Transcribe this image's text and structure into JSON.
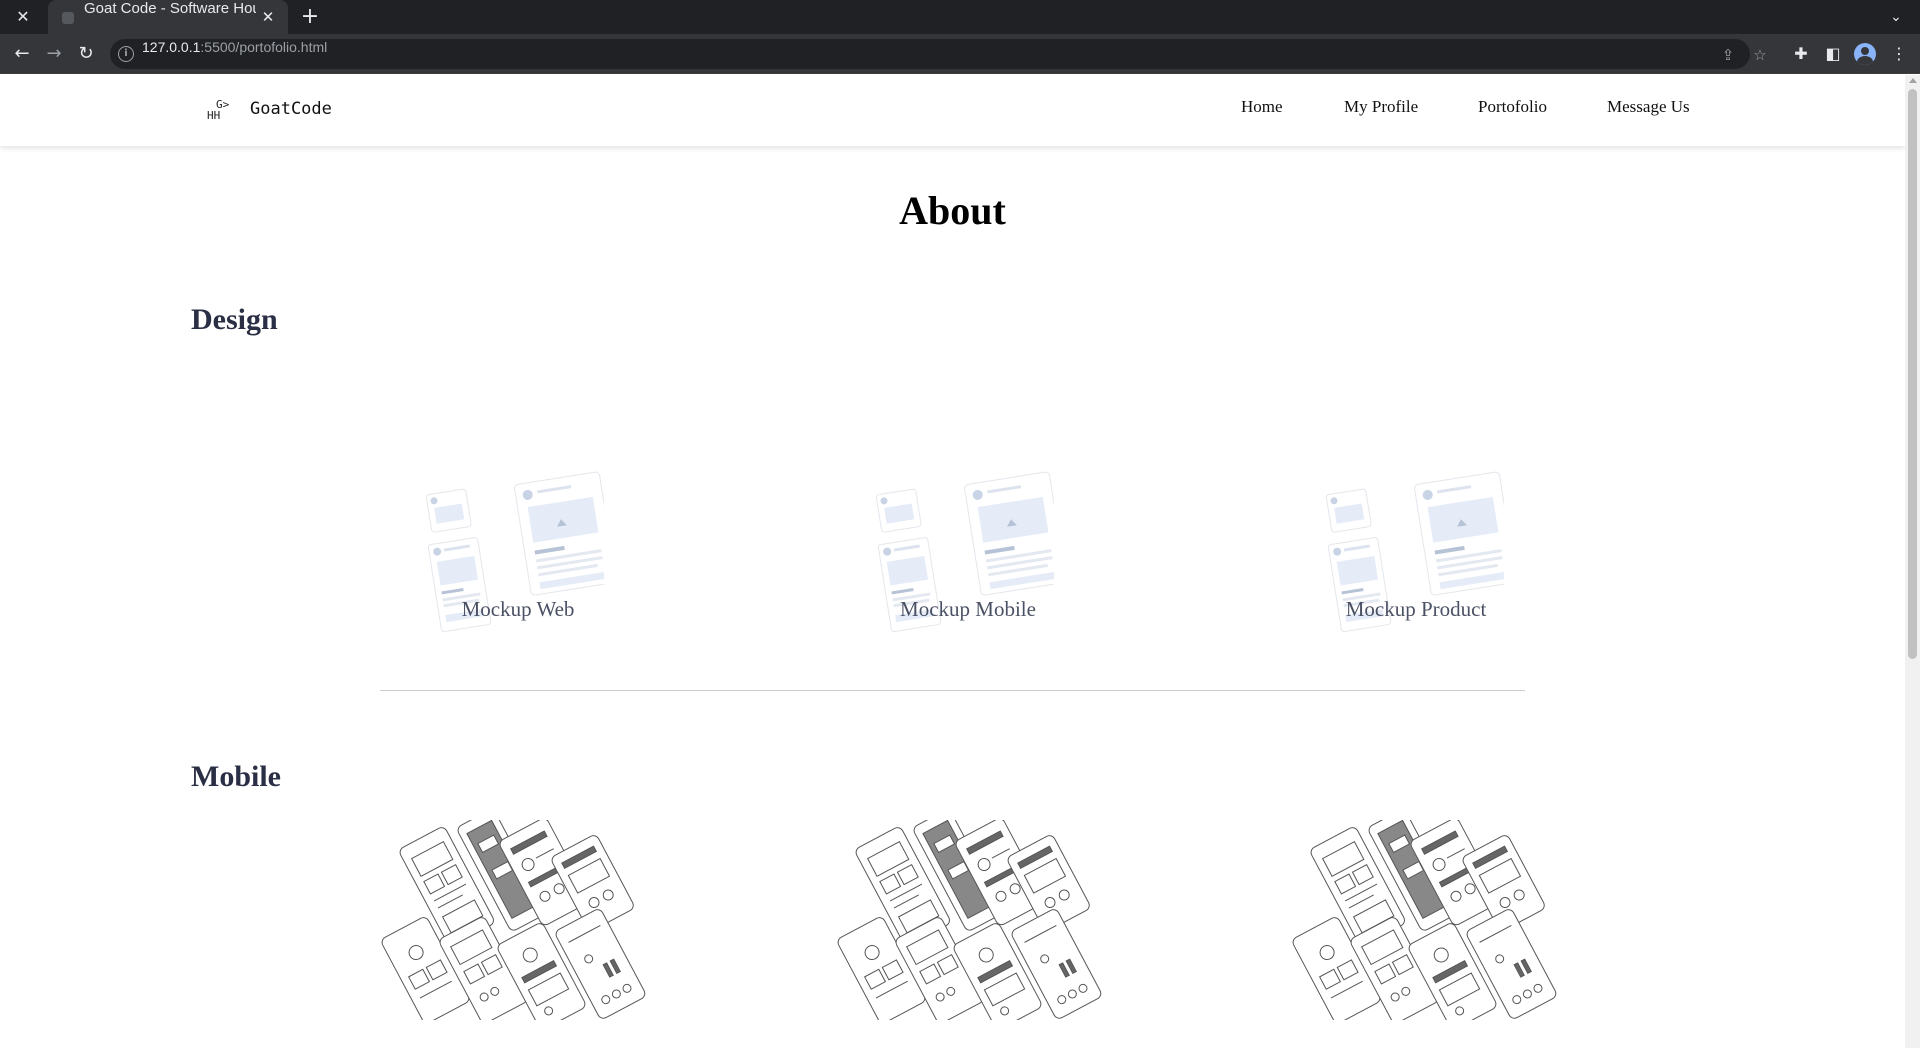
{
  "browser": {
    "tab_close_left_icon": "close-icon",
    "tab_title": "Goat Code - Software House",
    "tab_close": "✕",
    "new_tab": "+",
    "tab_dropdown": "⌄",
    "url_host": "127.0.0.1",
    "url_rest": ":5500/portofolio.html",
    "back": "←",
    "forward": "→",
    "reload": "↻",
    "info": "i",
    "share": "⇪",
    "star": "☆",
    "extensions": "✚",
    "sidepanel": "◧",
    "menu": "⋮"
  },
  "navbar": {
    "logo_line1": "G>",
    "logo_line2": "HH",
    "brand": "GoatCode",
    "links": [
      "Home",
      "My Profile",
      "Portofolio",
      "Message Us"
    ]
  },
  "page": {
    "title": "About",
    "sections": [
      {
        "heading": "Design",
        "cards": [
          {
            "label": "Mockup Web",
            "image": "wireframe-mockup"
          },
          {
            "label": "Mockup Mobile",
            "image": "wireframe-mockup"
          },
          {
            "label": "Mockup Product",
            "image": "wireframe-mockup"
          }
        ]
      },
      {
        "heading": "Mobile",
        "cards": [
          {
            "image": "mobile-app-sketches"
          },
          {
            "image": "mobile-app-sketches"
          },
          {
            "image": "mobile-app-sketches"
          }
        ]
      }
    ]
  },
  "colors": {
    "section_heading": "#2b2f45",
    "card_label": "#4b5164",
    "wireframe_fill": "#dfe8f6",
    "sketch_stroke": "#555555"
  }
}
